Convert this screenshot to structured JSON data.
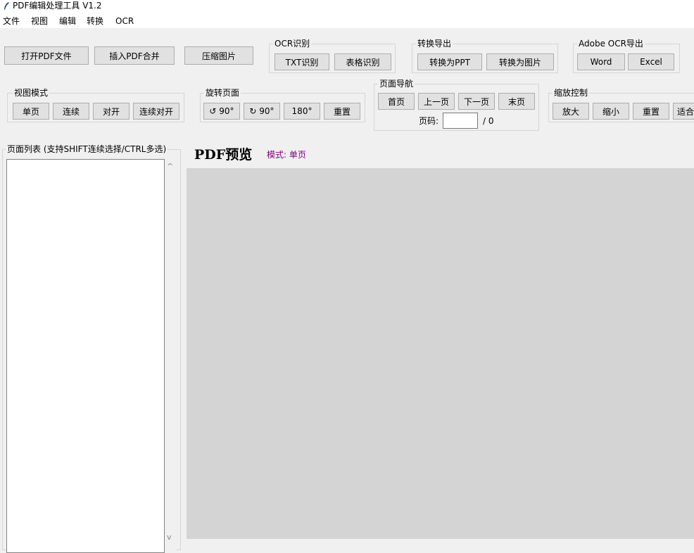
{
  "window": {
    "title": "PDF编辑处理工具 V1.2",
    "icon": "feather-icon"
  },
  "menu": [
    "文件",
    "视图",
    "编辑",
    "转换",
    "OCR"
  ],
  "toolbar": {
    "open_pdf": "打开PDF文件",
    "insert_merge": "插入PDF合并",
    "compress_images": "压缩图片"
  },
  "ocr_group": {
    "label": "OCR识别",
    "txt": "TXT识别",
    "table": "表格识别"
  },
  "convert_group": {
    "label": "转换导出",
    "ppt": "转换为PPT",
    "image": "转换为图片"
  },
  "adobe_group": {
    "label": "Adobe OCR导出",
    "word": "Word",
    "excel": "Excel"
  },
  "view_group": {
    "label": "视图模式",
    "single": "单页",
    "continuous": "连续",
    "facing": "对开",
    "continuous_facing": "连续对开"
  },
  "rotate_group": {
    "label": "旋转页面",
    "ccw": "↺ 90°",
    "cw": "↻ 90°",
    "r180": "180°",
    "reset": "重置"
  },
  "nav_group": {
    "label": "页面导航",
    "first": "首页",
    "prev": "上一页",
    "next": "下一页",
    "last": "末页",
    "page_label": "页码:",
    "page_value": "",
    "total": "/ 0"
  },
  "zoom_group": {
    "label": "缩放控制",
    "in": "放大",
    "out": "缩小",
    "reset": "重置",
    "fit": "适合"
  },
  "page_list": {
    "label": "页面列表 (支持SHIFT连续选择/CTRL多选)",
    "scroll_up": "^",
    "scroll_down": "v"
  },
  "preview": {
    "title": "PDF预览",
    "mode": "模式: 单页"
  },
  "colors": {
    "mode_text": "#800080",
    "preview_bg": "#d4d4d4",
    "window_bg": "#f0f0f0"
  }
}
